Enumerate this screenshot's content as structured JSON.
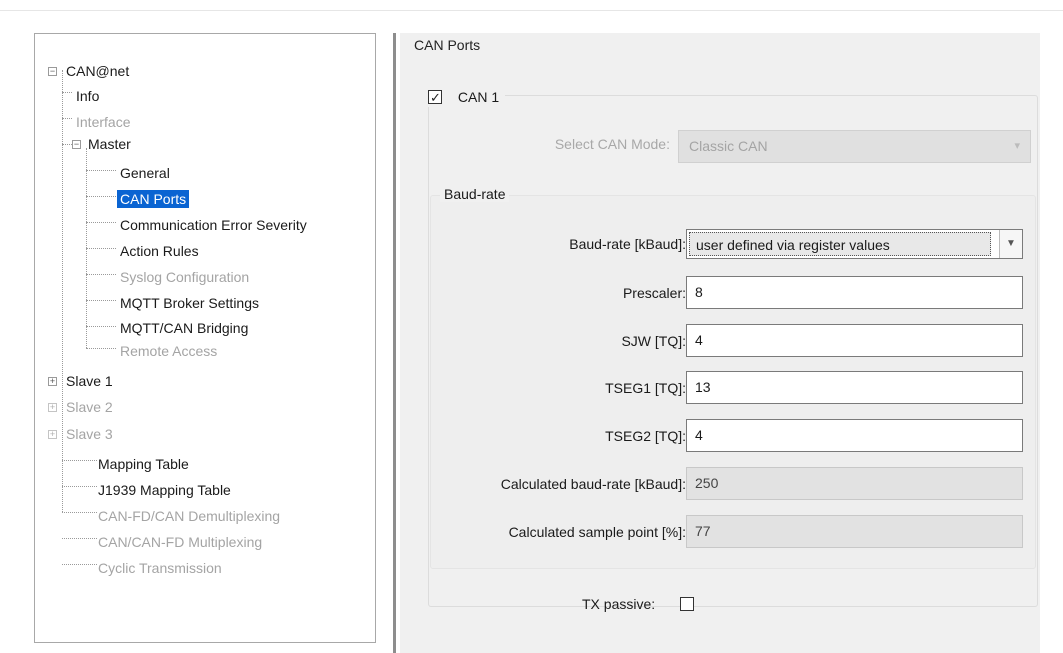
{
  "tree": {
    "root": "CAN@net",
    "info": "Info",
    "interface": "Interface",
    "master": "Master",
    "general": "General",
    "can_ports": "CAN Ports",
    "comm_error": "Communication Error Severity",
    "action_rules": "Action Rules",
    "syslog": "Syslog Configuration",
    "mqtt_broker": "MQTT Broker Settings",
    "mqtt_can": "MQTT/CAN Bridging",
    "remote_access": "Remote Access",
    "slave1": "Slave 1",
    "slave2": "Slave 2",
    "slave3": "Slave 3",
    "mapping_table": "Mapping Table",
    "j1939": "J1939 Mapping Table",
    "canfd_demux": "CAN-FD/CAN Demultiplexing",
    "canfd_mux": "CAN/CAN-FD Multiplexing",
    "cyclic": "Cyclic Transmission"
  },
  "panel": {
    "title": "CAN Ports",
    "can1_label": "CAN 1",
    "can1_checked": true,
    "mode_label": "Select CAN Mode:",
    "mode_value": "Classic CAN",
    "baud_group": "Baud-rate",
    "baud_label": "Baud-rate [kBaud]:",
    "baud_value": "user defined via register values",
    "prescaler_label": "Prescaler:",
    "prescaler_value": "8",
    "sjw_label": "SJW [TQ]:",
    "sjw_value": "4",
    "tseg1_label": "TSEG1 [TQ]:",
    "tseg1_value": "13",
    "tseg2_label": "TSEG2 [TQ]:",
    "tseg2_value": "4",
    "calc_baud_label": "Calculated baud-rate [kBaud]:",
    "calc_baud_value": "250",
    "calc_sample_label": "Calculated sample point [%]:",
    "calc_sample_value": "77",
    "tx_passive_label": "TX passive:",
    "tx_passive_checked": false
  },
  "colors": {
    "selection": "#0a64d2",
    "disabled_text": "#a4a4a4",
    "panel_bg": "#f0f0f0"
  }
}
